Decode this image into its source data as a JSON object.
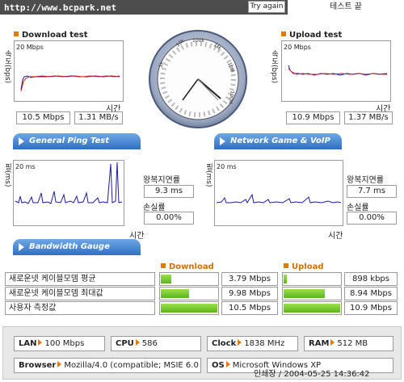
{
  "header": {
    "url": "http://www.bcpark.net",
    "try_again": "Try again",
    "finish": "테스트 끝"
  },
  "download": {
    "title": "Download test",
    "scale": "20 Mbps",
    "ylabel": "속도(bps)",
    "xlabel": "시간",
    "mbps": "10.5 Mbps",
    "mbs": "1.31 MB/s"
  },
  "upload": {
    "title": "Upload test",
    "scale": "20 Mbps",
    "ylabel": "속도(bps)",
    "xlabel": "시간",
    "mbps": "10.9 Mbps",
    "mbs": "1.37 MB/s"
  },
  "tabs": {
    "ping": "General Ping Test",
    "game": "Network Game & VoIP Test",
    "gauge": "Bandwidth Gauge"
  },
  "ping": {
    "scale": "20 ms",
    "ylabel": "핑(ms)",
    "xlabel": "시간",
    "latency_label": "왕복지연률",
    "latency": "9.3 ms",
    "loss_label": "손실률",
    "loss": "0.00%"
  },
  "game": {
    "scale": "20 ms",
    "ylabel": "핑(ms)",
    "xlabel": "시간",
    "latency_label": "왕복지연률",
    "latency": "7.7 ms",
    "loss_label": "손실률",
    "loss": "0.00%"
  },
  "gauge": {
    "download_header": "Download",
    "upload_header": "Upload",
    "rows": [
      {
        "label": "새로운넷 케이블모뎀 평균",
        "down": "3.79 Mbps",
        "down_level": 0.19,
        "up": "898 kbps",
        "up_level": 0.05
      },
      {
        "label": "새로운넷 케이블모뎀 최대값",
        "down": "9.98 Mbps",
        "down_level": 0.5,
        "up": "8.94 Mbps",
        "up_level": 0.73
      },
      {
        "label": "사용자 측정값",
        "down": "10.5 Mbps",
        "down_level": 1.0,
        "up": "10.9 Mbps",
        "up_level": 1.0
      }
    ]
  },
  "system": {
    "lan_label": "LAN",
    "lan": "100 Mbps",
    "cpu_label": "CPU",
    "cpu": "586",
    "clock_label": "Clock",
    "clock": "1838 MHz",
    "ram_label": "RAM",
    "ram": "512 MB",
    "browser_label": "Browser",
    "browser": "Mozilla/4.0 (compatible; MSIE 6.0",
    "os_label": "OS",
    "os": "Microsoft Windows XP"
  },
  "footer": {
    "date": "인쇄장 / 2004-05-25 14:36:42"
  },
  "colors": {
    "accent": "#e07a10",
    "tab_blue": "#2f6fc2",
    "line_blue": "#1a1aa0",
    "line_red": "#d02020",
    "bar_green": "#6cc82a"
  }
}
